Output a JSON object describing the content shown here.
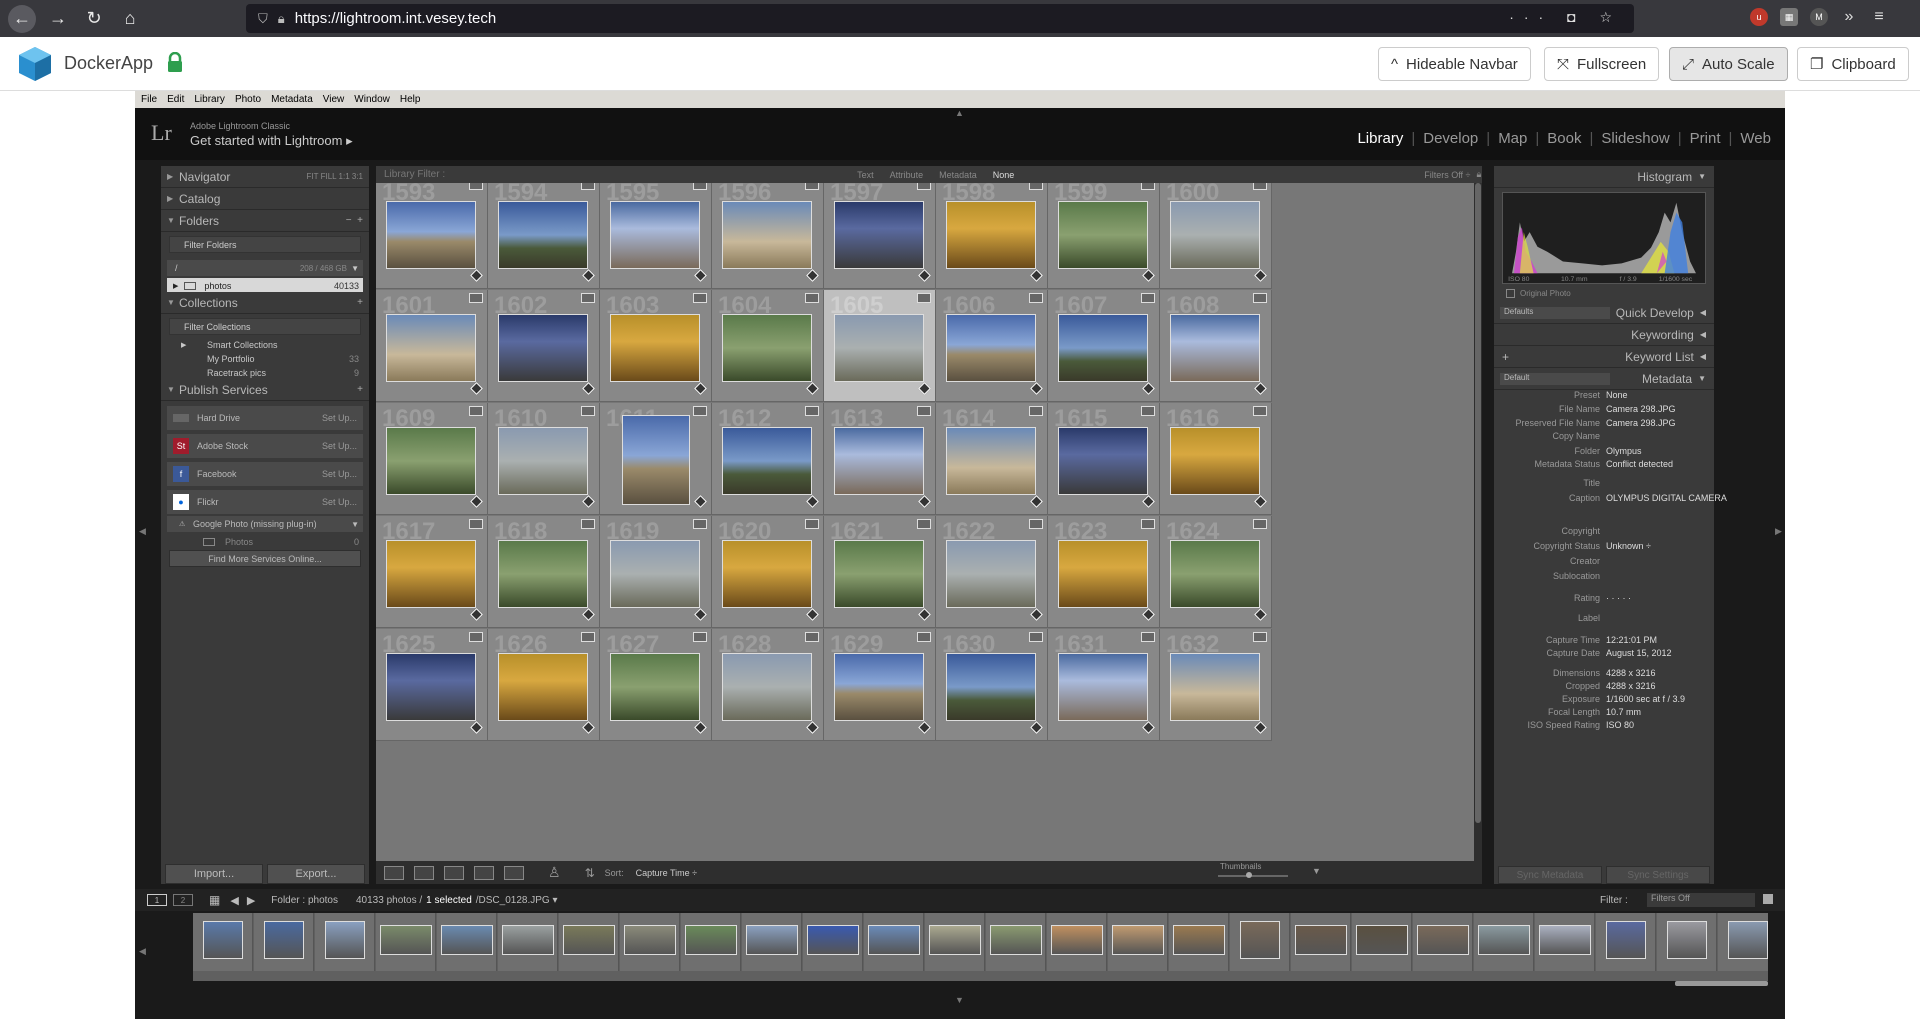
{
  "browser": {
    "url": "https://lightroom.int.vesey.tech",
    "actions": "··· ◘ ☆"
  },
  "docker": {
    "app_name": "DockerApp",
    "buttons": [
      {
        "label": "Hideable Navbar",
        "icon": "^"
      },
      {
        "label": "Fullscreen",
        "icon": "⤧"
      },
      {
        "label": "Auto Scale",
        "icon": "⤢"
      },
      {
        "label": "Clipboard",
        "icon": "❐"
      }
    ]
  },
  "menu": [
    "File",
    "Edit",
    "Library",
    "Photo",
    "Metadata",
    "View",
    "Window",
    "Help"
  ],
  "lightroom": {
    "logo": "Lr",
    "subtitle": "Adobe Lightroom Classic",
    "identity": "Get started with Lightroom",
    "modules": [
      "Library",
      "Develop",
      "Map",
      "Book",
      "Slideshow",
      "Print",
      "Web"
    ],
    "active_module": "Library"
  },
  "left_panel": {
    "navigator": "Navigator",
    "navigator_zoom": "FIT  FILL  1:1  3:1",
    "catalog": "Catalog",
    "folders": "Folders",
    "filter_folders": "Filter Folders",
    "volume_name": "/",
    "volume_space": "208 / 468 GB",
    "folder_name": "photos",
    "folder_count": "40133",
    "collections": "Collections",
    "filter_collections": "Filter Collections",
    "collection_items": [
      {
        "name": "Smart Collections",
        "count": ""
      },
      {
        "name": "My Portfolio",
        "count": "33"
      },
      {
        "name": "Racetrack pics",
        "count": "9"
      }
    ],
    "publish_services": "Publish Services",
    "services": [
      {
        "name": "Hard Drive",
        "action": "Set Up..."
      },
      {
        "name": "Adobe Stock",
        "action": "Set Up..."
      },
      {
        "name": "Facebook",
        "action": "Set Up..."
      },
      {
        "name": "Flickr",
        "action": "Set Up..."
      }
    ],
    "google_photo": "Google Photo (missing plug-in)",
    "google_sub": "Photos",
    "google_sub_count": "0",
    "find_more": "Find More Services Online...",
    "import": "Import...",
    "export": "Export..."
  },
  "library_filter": {
    "label": "Library Filter :",
    "options": [
      "Text",
      "Attribute",
      "Metadata",
      "None"
    ],
    "status": "Filters Off ÷"
  },
  "grid": {
    "numbers": [
      "1593",
      "1594",
      "1595",
      "1596",
      "1597",
      "1598",
      "1599",
      "1600",
      "1601",
      "1602",
      "1603",
      "1604",
      "1605",
      "1606",
      "1607",
      "1608",
      "1609",
      "1610",
      "1611",
      "1612",
      "1613",
      "1614",
      "1615",
      "1616",
      "1617",
      "1618",
      "1619",
      "1620",
      "1621",
      "1622",
      "1623",
      "1624",
      "1625",
      "1626",
      "1627",
      "1628",
      "1629",
      "1630",
      "1631",
      "1632"
    ],
    "selected_index": 12
  },
  "toolbar": {
    "sort_label": "Sort:",
    "sort_value": "Capture Time ÷",
    "thumbnails_label": "Thumbnails"
  },
  "right_panel": {
    "histogram": "Histogram",
    "hist_info": [
      "ISO 80",
      "10.7 mm",
      "f / 3.9",
      "1/1600 sec"
    ],
    "original_photo": "Original Photo",
    "quick_develop_preset": "Defaults",
    "quick_develop": "Quick Develop",
    "keywording": "Keywording",
    "keyword_list": "Keyword List",
    "metadata_preset": "Default",
    "metadata": "Metadata",
    "fields": [
      {
        "k": "Preset",
        "v": "None"
      },
      {
        "k": "File Name",
        "v": "Camera 298.JPG"
      },
      {
        "k": "Preserved File Name",
        "v": "Camera 298.JPG"
      },
      {
        "k": "Copy Name",
        "v": ""
      },
      {
        "k": "Folder",
        "v": "Olympus"
      },
      {
        "k": "Metadata Status",
        "v": "Conflict detected"
      },
      {
        "k": "Title",
        "v": ""
      },
      {
        "k": "Caption",
        "v": "OLYMPUS DIGITAL CAMERA"
      },
      {
        "k": "Copyright",
        "v": ""
      },
      {
        "k": "Copyright Status",
        "v": "Unknown ÷"
      },
      {
        "k": "Creator",
        "v": ""
      },
      {
        "k": "Sublocation",
        "v": ""
      },
      {
        "k": "Rating",
        "v": "· · · · ·"
      },
      {
        "k": "Label",
        "v": ""
      },
      {
        "k": "Capture Time",
        "v": "12:21:01 PM"
      },
      {
        "k": "Capture Date",
        "v": "August 15, 2012"
      },
      {
        "k": "Dimensions",
        "v": "4288 x 3216"
      },
      {
        "k": "Cropped",
        "v": "4288 x 3216"
      },
      {
        "k": "Exposure",
        "v": "1/1600 sec at f / 3.9"
      },
      {
        "k": "Focal Length",
        "v": "10.7 mm"
      },
      {
        "k": "ISO Speed Rating",
        "v": "ISO 80"
      }
    ],
    "sync_metadata": "Sync Metadata",
    "sync_settings": "Sync Settings"
  },
  "filmstrip": {
    "view1": "1",
    "view2": "2",
    "breadcrumb": "Folder : photos",
    "count": "40133 photos /",
    "selected": "1 selected",
    "file": "/DSC_0128.JPG ▾",
    "filter_label": "Filter :",
    "filter_value": "Filters Off"
  },
  "colors": {
    "sky": "#3a5a9a",
    "stone": "#8a7a5a",
    "gold": "#b8902a",
    "green": "#4a6a3a"
  }
}
